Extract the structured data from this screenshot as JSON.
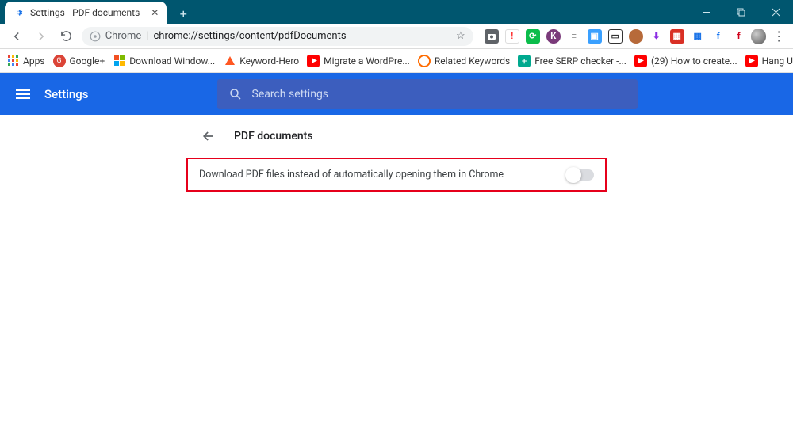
{
  "window": {
    "tab_title": "Settings - PDF documents"
  },
  "toolbar": {
    "scheme": "Chrome",
    "url_path": "chrome://settings/content/pdfDocuments"
  },
  "bookmarks": {
    "apps_label": "Apps",
    "items": [
      {
        "label": "Google+"
      },
      {
        "label": "Download Window..."
      },
      {
        "label": "Keyword-Hero"
      },
      {
        "label": "Migrate a WordPre..."
      },
      {
        "label": "Related Keywords"
      },
      {
        "label": "Free SERP checker -..."
      },
      {
        "label": "(29) How to create..."
      },
      {
        "label": "Hang Ups (Want Yo..."
      }
    ]
  },
  "settings": {
    "app_title": "Settings",
    "search_placeholder": "Search settings",
    "page_title": "PDF documents",
    "row_label": "Download PDF files instead of automatically opening them in Chrome"
  }
}
